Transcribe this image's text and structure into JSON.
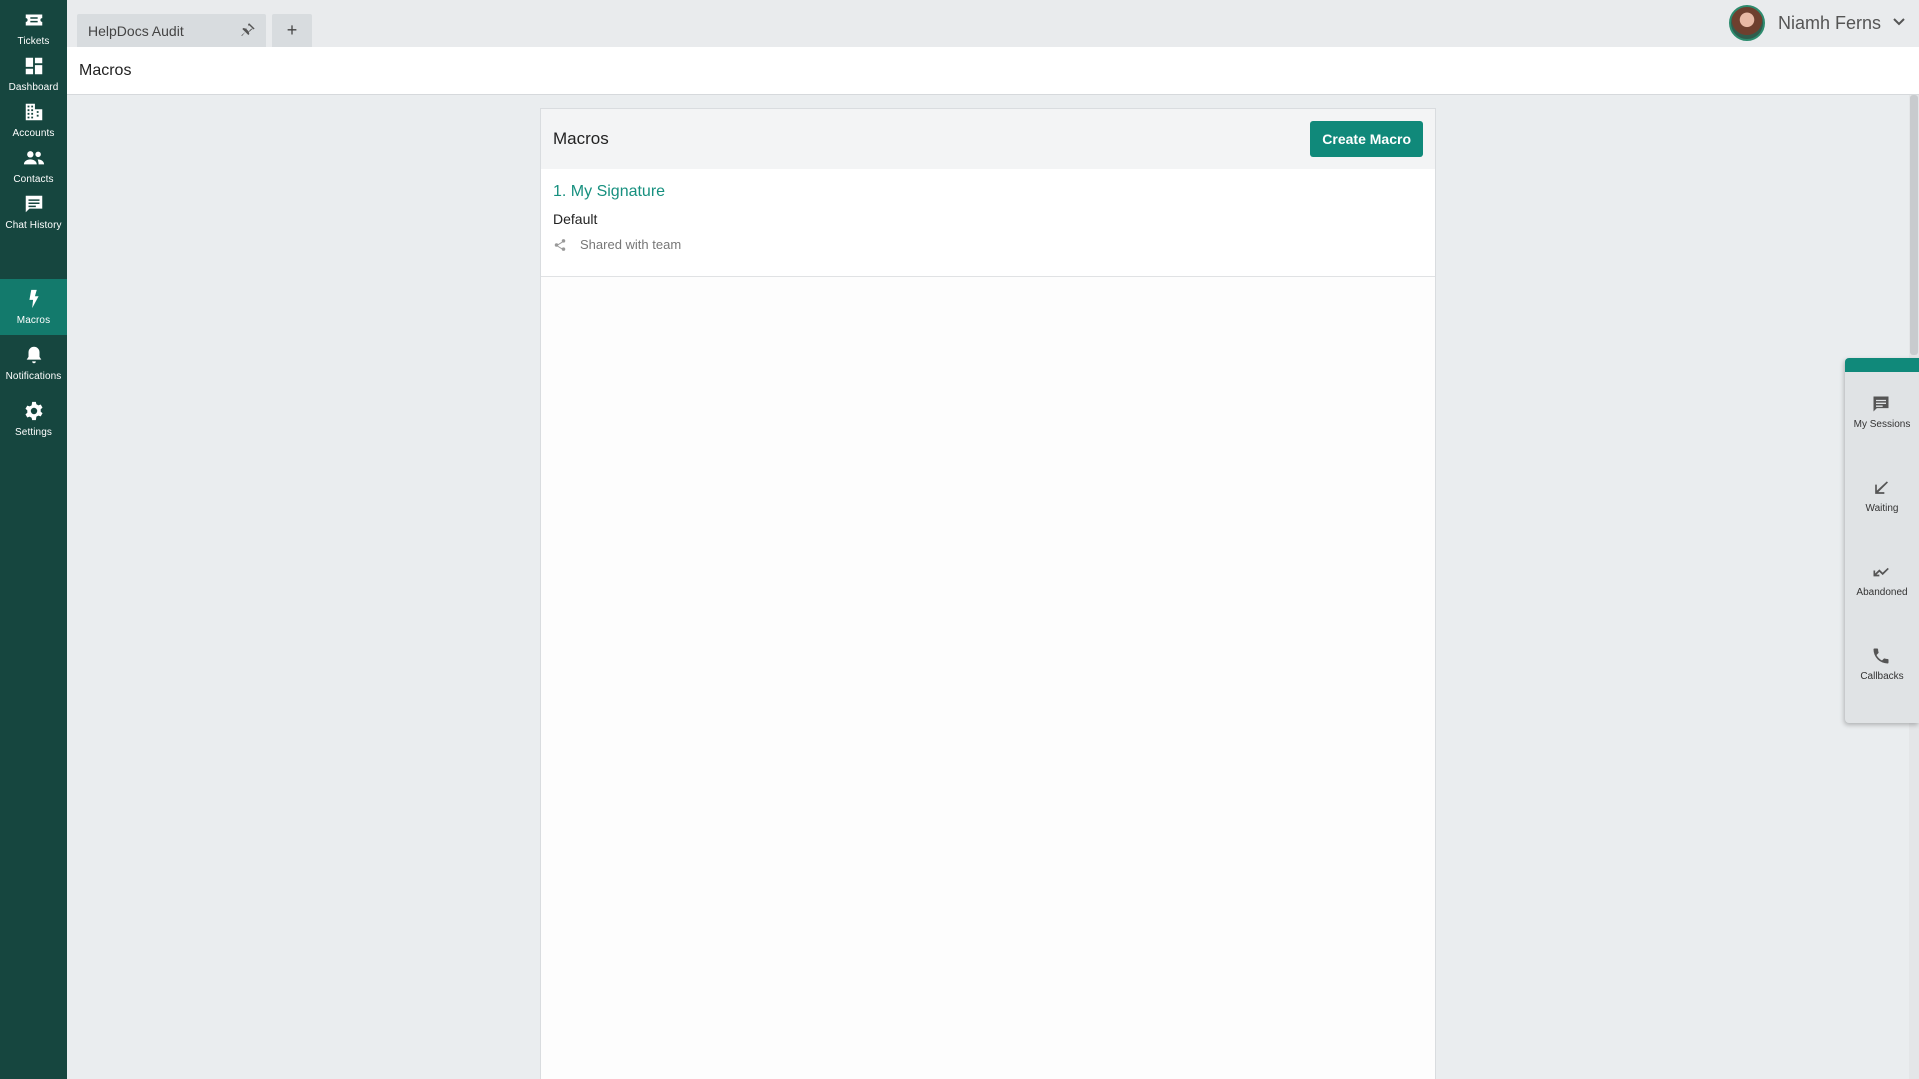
{
  "sidebar": {
    "items": [
      {
        "label": "Tickets",
        "icon": "ticket-icon"
      },
      {
        "label": "Dashboard",
        "icon": "dashboard-icon"
      },
      {
        "label": "Accounts",
        "icon": "building-icon"
      },
      {
        "label": "Contacts",
        "icon": "people-icon"
      },
      {
        "label": "Chat History",
        "icon": "chat-icon"
      },
      {
        "label": "Macros",
        "icon": "bolt-icon",
        "active": true
      },
      {
        "label": "Notifications",
        "icon": "bell-icon"
      },
      {
        "label": "Settings",
        "icon": "gear-icon"
      }
    ]
  },
  "tabs": {
    "items": [
      {
        "label": "HelpDocs Audit",
        "pinned": true
      }
    ],
    "add_label": "+"
  },
  "user": {
    "name": "Niamh Ferns"
  },
  "page": {
    "title": "Macros"
  },
  "panel": {
    "title": "Macros",
    "create_label": "Create Macro",
    "macros": [
      {
        "name": "1. My Signature",
        "category": "Default",
        "sharing": "Shared with team"
      }
    ]
  },
  "tray": {
    "items": [
      {
        "label": "My Sessions",
        "icon": "message-icon"
      },
      {
        "label": "Waiting",
        "icon": "arrow-down-left-icon"
      },
      {
        "label": "Abandoned",
        "icon": "arrow-return-icon"
      },
      {
        "label": "Callbacks",
        "icon": "phone-icon"
      }
    ]
  },
  "colors": {
    "sidebar_bg": "#16463f",
    "sidebar_active": "#137a6c",
    "accent": "#10897a",
    "link": "#17907f"
  }
}
